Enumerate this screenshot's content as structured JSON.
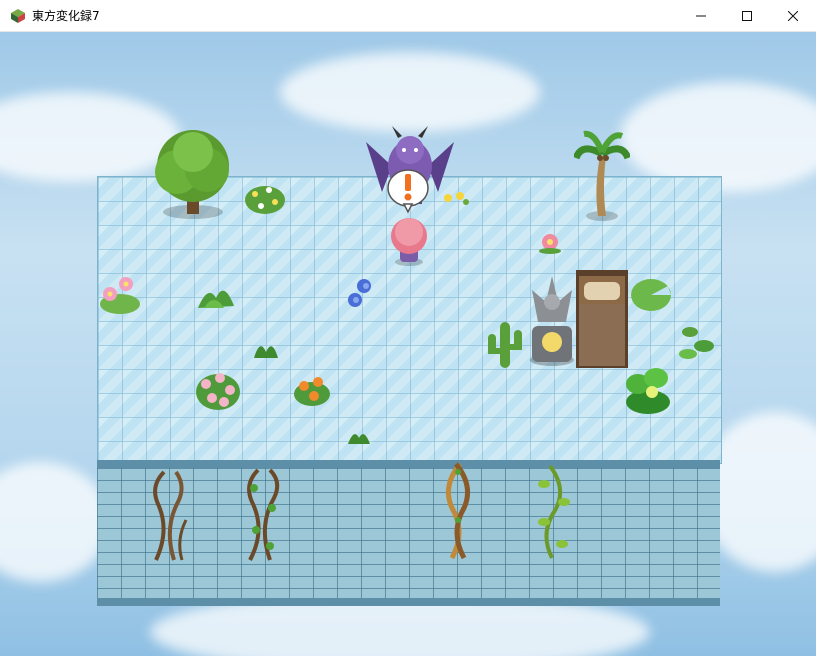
{
  "window": {
    "title": "東方変化録7",
    "icons": [
      "app-icon",
      "minimize-icon",
      "maximize-icon",
      "close-icon"
    ]
  },
  "map": {
    "objects": [
      "tree",
      "flower-bush",
      "demon-npc",
      "exclamation-balloon",
      "player-character",
      "palm-tree",
      "lotus-flowers",
      "weed",
      "hydrangea",
      "small-grass",
      "flower-pot",
      "cactus",
      "gargoyle-statue",
      "bed",
      "lily-pad",
      "leaf-cluster",
      "pink-flower-bush",
      "orange-flowers",
      "small-sprout",
      "vines"
    ],
    "colors": {
      "floor": "#bfe3f2",
      "wall": "#9bc7d6",
      "sky": "#b4d6ee"
    }
  }
}
